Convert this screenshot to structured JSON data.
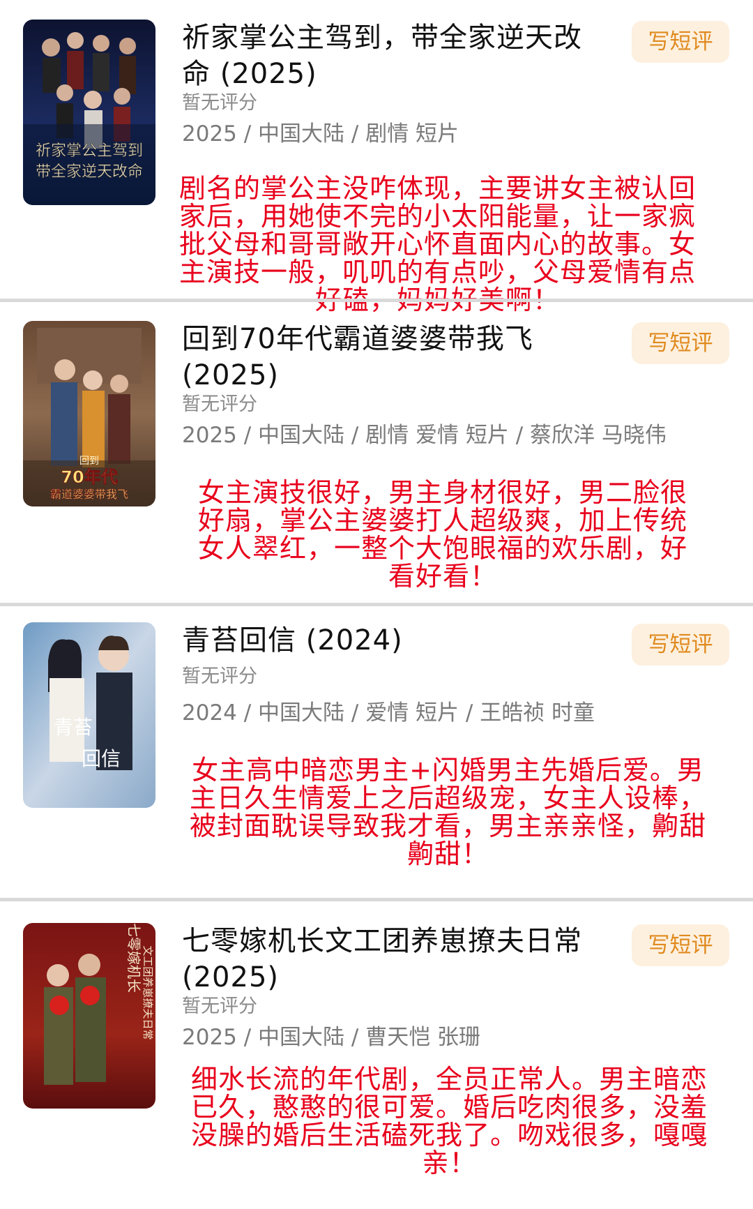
{
  "list": [
    {
      "title": "祈家掌公主驾到，带全家逆天改命 (2025)",
      "rating": "暂无评分",
      "meta": "2025 / 中国大陆 / 剧情 短片",
      "button": "写短评",
      "comment": "剧名的掌公主没咋体现，主要讲女主被认回家后，用她使不完的小太阳能量，让一家疯批父母和哥哥敞开心怀直面内心的故事。女主演技一般，叽叽的有点吵，父母爱情有点好磕，妈妈好美啊！",
      "poster_text": [
        "祈家掌公主驾到",
        "带全家逆天改命"
      ]
    },
    {
      "title": "回到70年代霸道婆婆带我飞 (2025)",
      "rating": "暂无评分",
      "meta": "2025 / 中国大陆 / 剧情 爱情 短片 / 蔡欣洋 马晓伟",
      "button": "写短评",
      "comment": "女主演技很好，男主身材很好，男二脸很好扇，掌公主婆婆打人超级爽，加上传统女人翠红，一整个大饱眼福的欢乐剧，好看好看！",
      "poster_text": [
        "回到",
        "70年代",
        "霸道婆婆带我飞"
      ]
    },
    {
      "title": "青苔回信 (2024)",
      "rating": "暂无评分",
      "meta": "2024 / 中国大陆 / 爱情 短片 / 王皓祯 时童",
      "button": "写短评",
      "comment": "女主高中暗恋男主+闪婚男主先婚后爱。男主日久生情爱上之后超级宠，女主人设棒，被封面耽误导致我才看，男主亲亲怪，齁甜齁甜！",
      "poster_text": [
        "青苔",
        "回信"
      ]
    },
    {
      "title": "七零嫁机长文工团养崽撩夫日常 (2025)",
      "rating": "暂无评分",
      "meta": "2025 / 中国大陆 / 曹天恺 张珊",
      "button": "写短评",
      "comment": "细水长流的年代剧，全员正常人。男主暗恋已久，憨憨的很可爱。婚后吃肉很多，没羞没臊的婚后生活磕死我了。吻戏很多，嘎嘎亲！",
      "poster_text": [
        "七零嫁机长",
        "文工团养崽撩夫日常"
      ]
    }
  ],
  "colors": {
    "comment": "#e8001c",
    "button_bg": "#fdf0df",
    "button_text": "#e08a1e",
    "divider": "#d9d9d9"
  }
}
